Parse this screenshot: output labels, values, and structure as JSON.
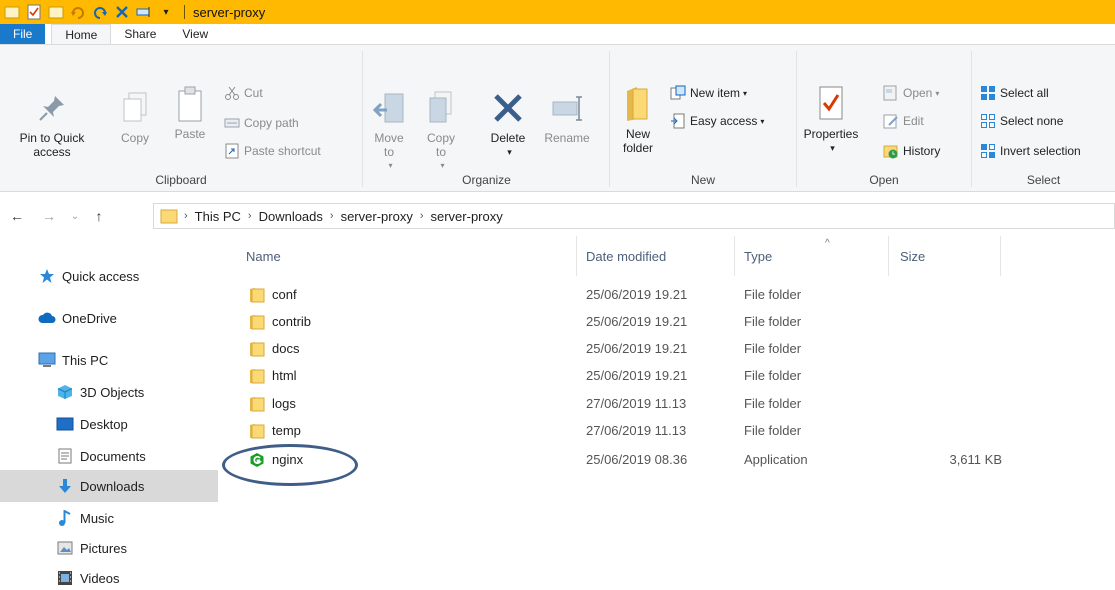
{
  "window": {
    "title": "server-proxy"
  },
  "ribbon_tabs": [
    "File",
    "Home",
    "Share",
    "View"
  ],
  "clipboard": {
    "label": "Clipboard",
    "pin_label": "Pin to Quick access",
    "copy_label": "Copy",
    "paste_label": "Paste",
    "cut_label": "Cut",
    "copy_path_label": "Copy path",
    "paste_shortcut_label": "Paste shortcut"
  },
  "organize": {
    "label": "Organize",
    "move_to_label": "Move to",
    "copy_to_label": "Copy to",
    "delete_label": "Delete",
    "rename_label": "Rename"
  },
  "new": {
    "label": "New",
    "new_folder_label": "New folder",
    "new_item_label": "New item",
    "easy_access_label": "Easy access"
  },
  "open": {
    "label": "Open",
    "properties_label": "Properties",
    "open_label": "Open",
    "edit_label": "Edit",
    "history_label": "History"
  },
  "select": {
    "label": "Select",
    "select_all_label": "Select all",
    "select_none_label": "Select none",
    "invert_selection_label": "Invert selection"
  },
  "breadcrumb": [
    "This PC",
    "Downloads",
    "server-proxy",
    "server-proxy"
  ],
  "nav": {
    "quick_access": "Quick access",
    "onedrive": "OneDrive",
    "this_pc": "This PC",
    "objects_3d": "3D Objects",
    "desktop": "Desktop",
    "documents": "Documents",
    "downloads": "Downloads",
    "music": "Music",
    "pictures": "Pictures",
    "videos": "Videos"
  },
  "columns": {
    "name": "Name",
    "date": "Date modified",
    "type": "Type",
    "size": "Size"
  },
  "files": [
    {
      "name": "conf",
      "date": "25/06/2019 19.21",
      "type": "File folder",
      "size": ""
    },
    {
      "name": "contrib",
      "date": "25/06/2019 19.21",
      "type": "File folder",
      "size": ""
    },
    {
      "name": "docs",
      "date": "25/06/2019 19.21",
      "type": "File folder",
      "size": ""
    },
    {
      "name": "html",
      "date": "25/06/2019 19.21",
      "type": "File folder",
      "size": ""
    },
    {
      "name": "logs",
      "date": "27/06/2019 11.13",
      "type": "File folder",
      "size": ""
    },
    {
      "name": "temp",
      "date": "27/06/2019 11.13",
      "type": "File folder",
      "size": ""
    },
    {
      "name": "nginx",
      "date": "25/06/2019 08.36",
      "type": "Application",
      "size": "3,611 KB"
    }
  ],
  "colors": {
    "accent": "#ffb900",
    "file_tab": "#1979ca",
    "nginx_green": "#1b9e28",
    "oval": "#3f5d86"
  }
}
